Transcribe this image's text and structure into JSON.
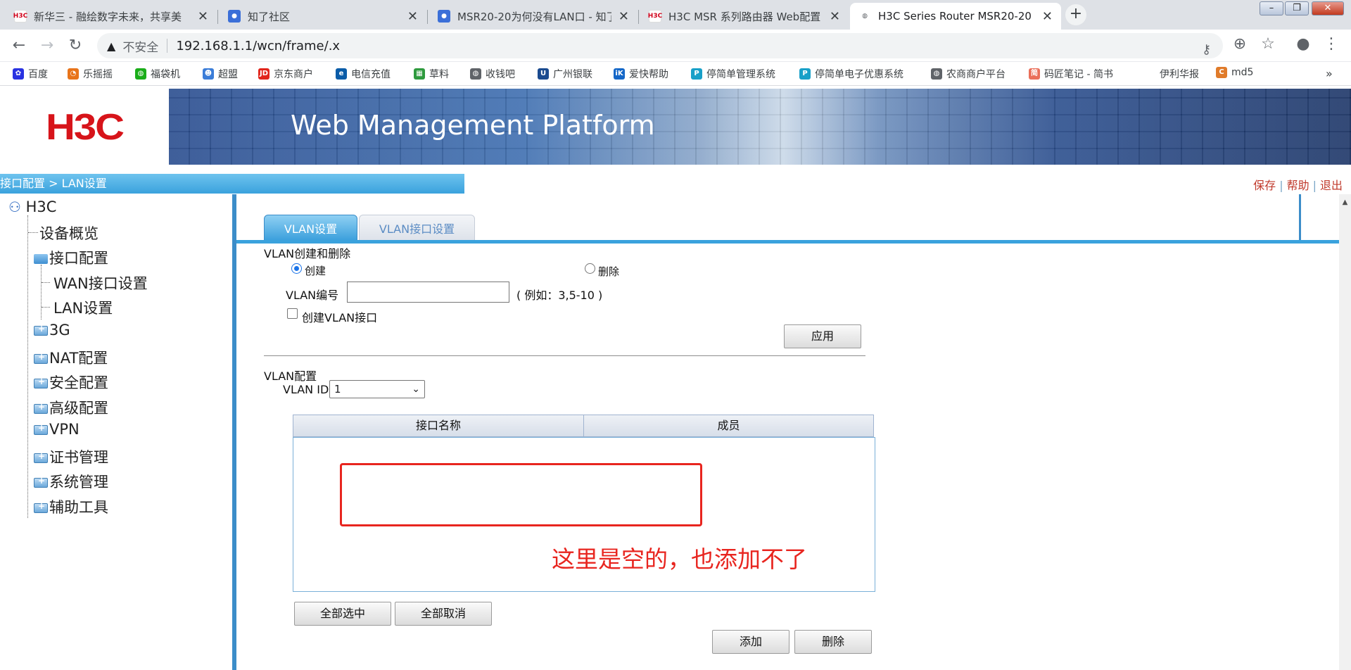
{
  "browser": {
    "tabs": [
      {
        "title": "新华三 - 融绘数字未来，共享美",
        "favicon": "h3c-favicon",
        "active": false
      },
      {
        "title": "知了社区",
        "favicon": "zhiliao-favicon",
        "active": false
      },
      {
        "title": "MSR20-20为何没有LAN口 - 知了",
        "favicon": "zhiliao-favicon",
        "active": false
      },
      {
        "title": "H3C MSR 系列路由器 Web配置",
        "favicon": "h3c-favicon",
        "active": false
      },
      {
        "title": "H3C Series Router MSR20-20",
        "favicon": "globe-icon",
        "active": true
      }
    ],
    "address": {
      "security_label": "不安全",
      "url": "192.168.1.1/wcn/frame/.x"
    },
    "bookmarks": [
      {
        "label": "百度",
        "icon": "paw-icon",
        "color": "#2932e1"
      },
      {
        "label": "乐摇摇",
        "icon": "swirl-icon",
        "color": "#e8741a"
      },
      {
        "label": "福袋机",
        "icon": "wechat-icon",
        "color": "#1aad19"
      },
      {
        "label": "超盟",
        "icon": "person-icon",
        "color": "#3b7dd8"
      },
      {
        "label": "京东商户",
        "icon": "jd-icon",
        "color": "#e1251b"
      },
      {
        "label": "电信充值",
        "icon": "telecom-icon",
        "color": "#0a5ca8"
      },
      {
        "label": "草料",
        "icon": "grid-icon",
        "color": "#2e9a3e"
      },
      {
        "label": "收钱吧",
        "icon": "globe-icon",
        "color": "#5f6368"
      },
      {
        "label": "广州银联",
        "icon": "unionpay-icon",
        "color": "#1a4a8f"
      },
      {
        "label": "爱快帮助",
        "icon": "ik-icon",
        "color": "#1467c8"
      },
      {
        "label": "停简单管理系统",
        "icon": "parking-icon",
        "color": "#18a0c8"
      },
      {
        "label": "停简单电子优惠系统",
        "icon": "parking-icon",
        "color": "#18a0c8"
      },
      {
        "label": "农商商户平台",
        "icon": "globe-icon",
        "color": "#5f6368"
      },
      {
        "label": "码匠笔记 - 简书",
        "icon": "jianshu-icon",
        "color": "#ea6f5a"
      },
      {
        "label": "伊利华报",
        "icon": "none",
        "color": "#ffffff"
      },
      {
        "label": "md5",
        "icon": "md5-icon",
        "color": "#e07b2a"
      }
    ],
    "bookmarks_overflow": "»"
  },
  "app": {
    "logo": "H3C",
    "platform_title": "Web Management Platform",
    "breadcrumb": "接口配置 > LAN设置",
    "top_links": [
      "保存",
      "帮助",
      "退出"
    ]
  },
  "tree": {
    "root": "H3C",
    "items": [
      {
        "label": "设备概览",
        "level": 1,
        "type": "leaf"
      },
      {
        "label": "接口配置",
        "level": 1,
        "type": "open-folder"
      },
      {
        "label": "WAN接口设置",
        "level": 2,
        "type": "leaf"
      },
      {
        "label": "LAN设置",
        "level": 2,
        "type": "leaf"
      },
      {
        "label": "3G",
        "level": 1,
        "type": "closed-folder"
      },
      {
        "label": "NAT配置",
        "level": 1,
        "type": "closed-folder"
      },
      {
        "label": "安全配置",
        "level": 1,
        "type": "closed-folder"
      },
      {
        "label": "高级配置",
        "level": 1,
        "type": "closed-folder"
      },
      {
        "label": "VPN",
        "level": 1,
        "type": "closed-folder"
      },
      {
        "label": "证书管理",
        "level": 1,
        "type": "closed-folder"
      },
      {
        "label": "系统管理",
        "level": 1,
        "type": "closed-folder"
      },
      {
        "label": "辅助工具",
        "level": 1,
        "type": "closed-folder"
      }
    ]
  },
  "content": {
    "tabs": [
      "VLAN设置",
      "VLAN接口设置"
    ],
    "active_tab": "VLAN设置",
    "create_delete_section": {
      "title": "VLAN创建和删除",
      "option_create": "创建",
      "option_delete": "删除",
      "selected_option": "创建",
      "vlan_id_label": "VLAN编号",
      "vlan_id_value": "",
      "vlan_id_hint": "( 例如：3,5-10 )",
      "create_interface_label": "创建VLAN接口",
      "create_interface_checked": false,
      "apply_button": "应用"
    },
    "config_section": {
      "title": "VLAN配置",
      "vlan_id_label": "VLAN ID",
      "vlan_id_selected": "1",
      "table_headers": [
        "接口名称",
        "成员"
      ],
      "rows": [],
      "select_all_button": "全部选中",
      "deselect_all_button": "全部取消",
      "add_button": "添加",
      "delete_button": "删除"
    }
  },
  "annotation": {
    "text": "这里是空的，也添加不了",
    "color": "#e8251f"
  }
}
